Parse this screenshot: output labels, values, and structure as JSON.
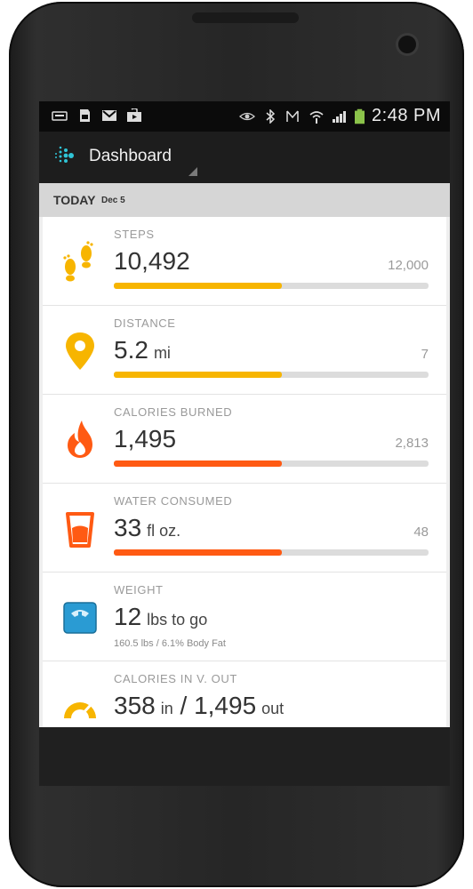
{
  "status_bar": {
    "time": "2:48 PM",
    "left_icons": [
      "keyboard-icon",
      "sd-card-icon",
      "gmail-icon",
      "play-store-icon"
    ],
    "right_icons": [
      "eye-icon",
      "bluetooth-icon",
      "mute-icon",
      "wifi-icon",
      "signal-icon",
      "battery-icon"
    ]
  },
  "app_bar": {
    "title": "Dashboard",
    "logo": "fitbit-logo-icon"
  },
  "today": {
    "label": "TODAY",
    "date": "Dec 5"
  },
  "colors": {
    "yellow": "#f7b500",
    "orange": "#ff5a13",
    "scale_blue": "#2a9bd3",
    "gray_track": "#dcdcdc"
  },
  "cards": [
    {
      "label": "STEPS",
      "value": "10,492",
      "unit": "",
      "goal": "12,000",
      "progress": 0.535,
      "color": "#f7b500",
      "icon": "footsteps-icon"
    },
    {
      "label": "DISTANCE",
      "value": "5.2",
      "unit": "mi",
      "goal": "7",
      "progress": 0.535,
      "color": "#f7b500",
      "icon": "location-pin-icon"
    },
    {
      "label": "CALORIES BURNED",
      "value": "1,495",
      "unit": "",
      "goal": "2,813",
      "progress": 0.535,
      "color": "#ff5a13",
      "icon": "flame-icon"
    },
    {
      "label": "WATER CONSUMED",
      "value": "33",
      "unit": "fl oz.",
      "goal": "48",
      "progress": 0.535,
      "color": "#ff5a13",
      "icon": "water-glass-icon"
    },
    {
      "label": "WEIGHT",
      "value": "12",
      "unit": "lbs to go",
      "sub": "160.5 lbs / 6.1% Body Fat",
      "icon": "scale-icon"
    },
    {
      "label": "CALORIES IN V. OUT",
      "value": "358",
      "in_unit": "in",
      "separator": "/",
      "value2": "1,495",
      "out_unit": "out",
      "icon": "gauge-icon"
    }
  ]
}
